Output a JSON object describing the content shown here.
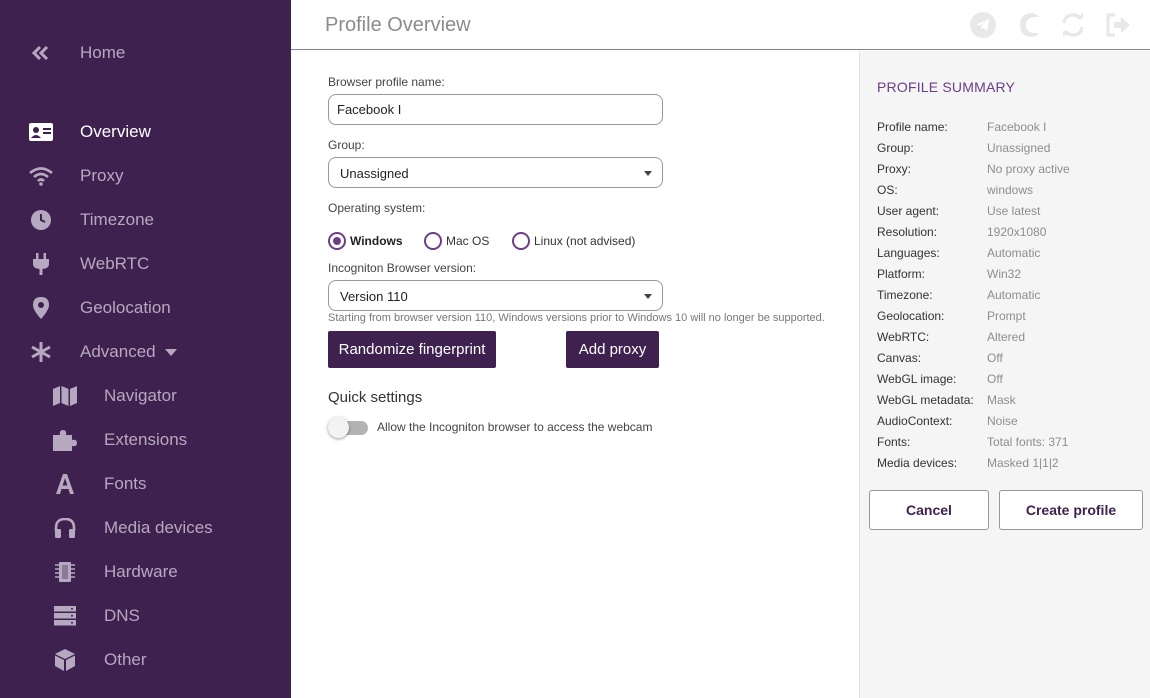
{
  "colors": {
    "sidebar_bg": "#3f2150",
    "accent": "#6b3e86",
    "sidebar_text": "#b6a8bf"
  },
  "sidebar": {
    "home": {
      "label": "Home",
      "icon": "double-chevron-left-icon"
    },
    "items": [
      {
        "label": "Overview",
        "icon": "id-card-icon",
        "active": true
      },
      {
        "label": "Proxy",
        "icon": "wifi-icon"
      },
      {
        "label": "Timezone",
        "icon": "clock-icon"
      },
      {
        "label": "WebRTC",
        "icon": "plug-icon"
      },
      {
        "label": "Geolocation",
        "icon": "map-pin-icon"
      },
      {
        "label": "Advanced",
        "icon": "asterisk-icon"
      }
    ],
    "advanced_items": [
      {
        "label": "Navigator",
        "icon": "map-icon"
      },
      {
        "label": "Extensions",
        "icon": "puzzle-icon"
      },
      {
        "label": "Fonts",
        "icon": "font-icon"
      },
      {
        "label": "Media devices",
        "icon": "headphones-icon"
      },
      {
        "label": "Hardware",
        "icon": "chip-icon"
      },
      {
        "label": "DNS",
        "icon": "server-icon"
      },
      {
        "label": "Other",
        "icon": "cube-icon"
      }
    ]
  },
  "header": {
    "title": "Profile Overview",
    "icons": [
      "telegram-icon",
      "moon-icon",
      "sync-icon",
      "logout-icon"
    ]
  },
  "form": {
    "profile_name_label": "Browser profile name:",
    "profile_name_value": "Facebook I",
    "group_label": "Group:",
    "group_value": "Unassigned",
    "os_label": "Operating system:",
    "os_options": [
      "Windows",
      "Mac OS",
      "Linux (not advised)"
    ],
    "os_selected": "Windows",
    "version_label": "Incogniton Browser version:",
    "version_value": "Version 110",
    "version_hint": "Starting from browser version 110, Windows versions prior to Windows 10 will no longer be supported.",
    "randomize_label": "Randomize fingerprint",
    "add_proxy_label": "Add proxy",
    "quick_settings_title": "Quick settings",
    "webcam_label": "Allow the Incogniton browser to access the webcam",
    "webcam_enabled": false
  },
  "summary": {
    "title": "PROFILE SUMMARY",
    "rows": [
      {
        "key": "Profile name:",
        "value": "Facebook I"
      },
      {
        "key": "Group:",
        "value": "Unassigned"
      },
      {
        "key": "Proxy:",
        "value": "No proxy active"
      },
      {
        "key": "OS:",
        "value": "windows"
      },
      {
        "key": "User agent:",
        "value": "Use latest"
      },
      {
        "key": "Resolution:",
        "value": "1920x1080"
      },
      {
        "key": "Languages:",
        "value": "Automatic"
      },
      {
        "key": "Platform:",
        "value": "Win32"
      },
      {
        "key": "Timezone:",
        "value": "Automatic"
      },
      {
        "key": "Geolocation:",
        "value": "Prompt"
      },
      {
        "key": "WebRTC:",
        "value": "Altered"
      },
      {
        "key": "Canvas:",
        "value": "Off"
      },
      {
        "key": "WebGL image:",
        "value": "Off"
      },
      {
        "key": "WebGL metadata:",
        "value": "Mask"
      },
      {
        "key": "AudioContext:",
        "value": "Noise"
      },
      {
        "key": "Fonts:",
        "value": "Total fonts: 371"
      },
      {
        "key": "Media devices:",
        "value": "Masked 1|1|2"
      }
    ],
    "cancel_label": "Cancel",
    "create_label": "Create profile"
  }
}
